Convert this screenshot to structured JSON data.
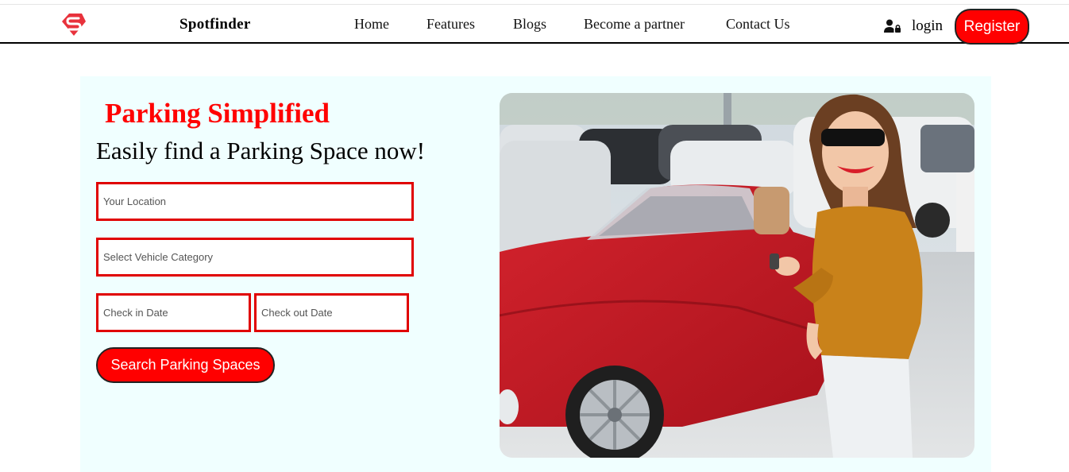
{
  "header": {
    "brand": "Spotfinder",
    "nav": [
      {
        "label": "Home"
      },
      {
        "label": "Features"
      },
      {
        "label": "Blogs"
      },
      {
        "label": "Become a partner"
      },
      {
        "label": "Contact Us"
      }
    ],
    "login_label": "login",
    "register_label": "Register"
  },
  "hero": {
    "headline": "Parking Simplified",
    "subheadline": "Easily find a Parking Space now!",
    "location_placeholder": "Your Location",
    "vehicle_placeholder": "Select Vehicle Category",
    "checkin_placeholder": "Check in Date",
    "checkout_placeholder": "Check out Date",
    "search_label": "Search Parking Spaces"
  },
  "colors": {
    "accent": "#ff0000",
    "hero_background": "#f0ffff",
    "field_border": "#e00000"
  },
  "icons": [
    "spotfinder-logo-icon",
    "user-icon"
  ]
}
